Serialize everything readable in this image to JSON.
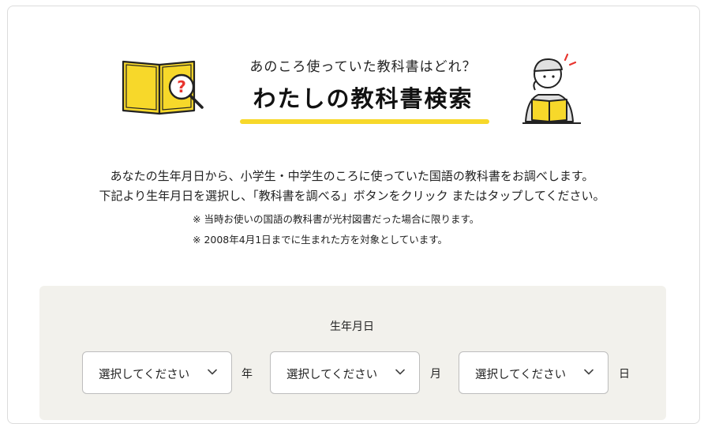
{
  "header": {
    "subtitle": "あのころ使っていた教科書はどれ？",
    "title": "わたしの教科書検索",
    "accent_color": "#f7d82a",
    "left_icon": "open-book-magnifier-icon",
    "right_icon": "person-reading-icon"
  },
  "description": {
    "line1": "あなたの生年月日から、小学生・中学生のころに使っていた国語の教科書をお調べします。",
    "line2": "下記より生年月日を選択し、「教科書を調べる」ボタンをクリック またはタップしてください。",
    "note1": "※ 当時お使いの国語の教科書が光村図書だった場合に限ります。",
    "note2": "※ 2008年4月1日までに生まれた方を対象としています。"
  },
  "form": {
    "label": "生年月日",
    "year_select": "選択してください",
    "year_unit": "年",
    "month_select": "選択してください",
    "month_unit": "月",
    "day_select": "選択してください",
    "day_unit": "日"
  }
}
